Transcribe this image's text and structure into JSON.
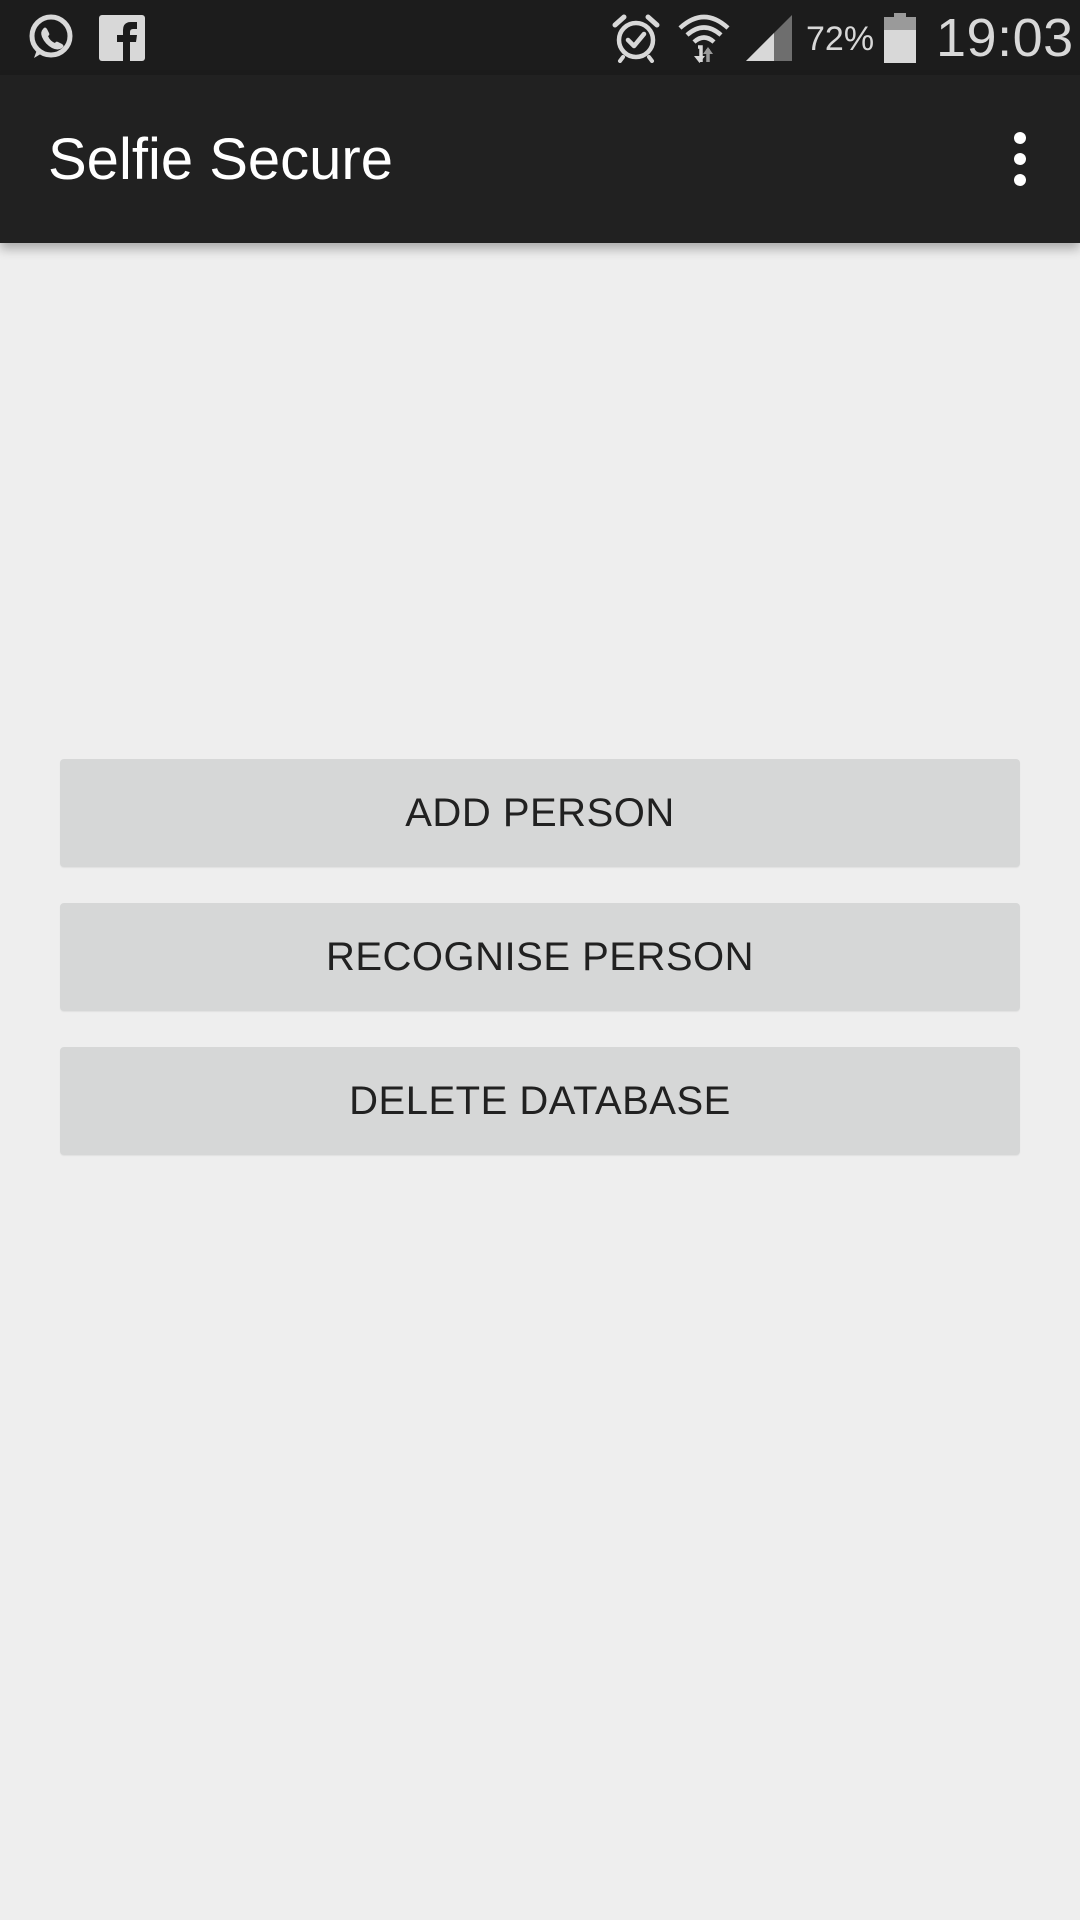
{
  "status_bar": {
    "notification_icons": [
      "whatsapp-icon",
      "facebook-icon"
    ],
    "system_icons": [
      "alarm-icon",
      "wifi-icon",
      "signal-icon",
      "battery-icon"
    ],
    "battery_percent": "72%",
    "time": "19:03"
  },
  "action_bar": {
    "title": "Selfie Secure",
    "overflow_icon": "more-vert-icon"
  },
  "buttons": {
    "add_person": "ADD PERSON",
    "recognise_person": "RECOGNISE PERSON",
    "delete_database": "DELETE DATABASE"
  },
  "colors": {
    "status_bar_bg": "#1c1c1c",
    "action_bar_bg": "#212121",
    "content_bg": "#eeeeee",
    "button_bg": "#d6d7d7",
    "button_text": "#212121"
  }
}
